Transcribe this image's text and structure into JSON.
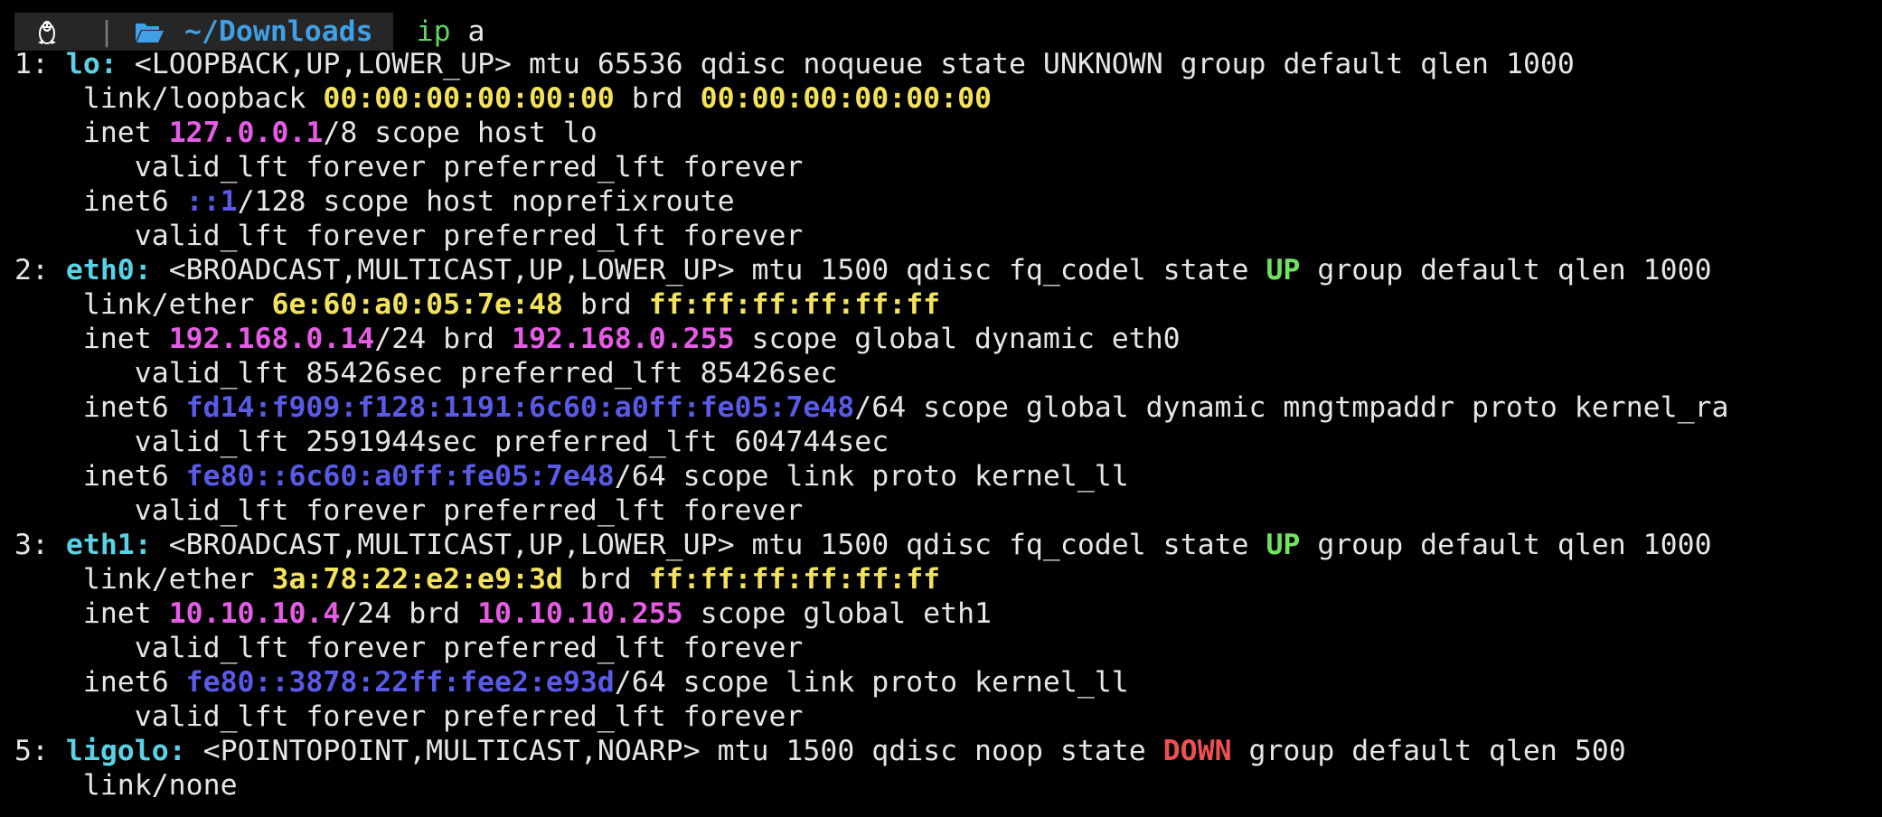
{
  "prompt": {
    "os_icon": "linux-tux-icon",
    "separator": "|",
    "folder_icon": "folder-open-icon",
    "directory": "~/Downloads",
    "command": "ip",
    "argument": "a"
  },
  "colors": {
    "interface_name": "#5ad2e6",
    "mac_address": "#f2e25c",
    "ipv4_address": "#e55ce5",
    "ipv6_address": "#5a5ae8",
    "state_up": "#6fe35f",
    "state_down": "#ef5050",
    "command": "#5fd75f",
    "directory": "#3fa0e6"
  },
  "output": [
    {
      "index": "1:",
      "name": "lo:",
      "flags": "<LOOPBACK,UP,LOWER_UP> mtu 65536 qdisc noqueue state",
      "state": "UNKNOWN",
      "state_class": "st-plain",
      "tail": "group default qlen 1000",
      "link_type": "link/loopback",
      "mac": "00:00:00:00:00:00",
      "brd_mac": "00:00:00:00:00:00",
      "inet": {
        "addr": "127.0.0.1",
        "suffix": "/8 scope host lo"
      },
      "inet_lft": "valid_lft forever preferred_lft forever",
      "inet6_a": {
        "addr": "::1",
        "suffix": "/128 scope host noprefixroute"
      },
      "inet6_a_lft": "valid_lft forever preferred_lft forever"
    },
    {
      "index": "2:",
      "name": "eth0:",
      "flags": "<BROADCAST,MULTICAST,UP,LOWER_UP> mtu 1500 qdisc fq_codel state",
      "state": "UP",
      "tail": "group default qlen 1000",
      "link_type": "link/ether",
      "mac": "6e:60:a0:05:7e:48",
      "brd_mac": "ff:ff:ff:ff:ff:ff",
      "inet": {
        "addr": "192.168.0.14",
        "mid": "/24 brd",
        "brd": "192.168.0.255",
        "suffix": "scope global dynamic eth0"
      },
      "inet_lft": "valid_lft 85426sec preferred_lft 85426sec",
      "inet6_a": {
        "addr": "fd14:f909:f128:1191:6c60:a0ff:fe05:7e48",
        "suffix": "/64 scope global dynamic mngtmpaddr proto kernel_ra"
      },
      "inet6_a_lft": "valid_lft 2591944sec preferred_lft 604744sec",
      "inet6_b": {
        "addr": "fe80::6c60:a0ff:fe05:7e48",
        "suffix": "/64 scope link proto kernel_ll"
      },
      "inet6_b_lft": "valid_lft forever preferred_lft forever"
    },
    {
      "index": "3:",
      "name": "eth1:",
      "flags": "<BROADCAST,MULTICAST,UP,LOWER_UP> mtu 1500 qdisc fq_codel state",
      "state": "UP",
      "tail": "group default qlen 1000",
      "link_type": "link/ether",
      "mac": "3a:78:22:e2:e9:3d",
      "brd_mac": "ff:ff:ff:ff:ff:ff",
      "inet": {
        "addr": "10.10.10.4",
        "mid": "/24 brd",
        "brd": "10.10.10.255",
        "suffix": "scope global eth1"
      },
      "inet_lft": "valid_lft forever preferred_lft forever",
      "inet6_b": {
        "addr": "fe80::3878:22ff:fee2:e93d",
        "suffix": "/64 scope link proto kernel_ll"
      },
      "inet6_b_lft": "valid_lft forever preferred_lft forever"
    },
    {
      "index": "5:",
      "name": "ligolo:",
      "flags": "<POINTOPOINT,MULTICAST,NOARP> mtu 1500 qdisc noop state",
      "state": "DOWN",
      "tail": "group default qlen 500",
      "link_type": "link/none"
    }
  ],
  "labels": {
    "brd": "brd",
    "inet": "inet",
    "inet6": "inet6"
  }
}
